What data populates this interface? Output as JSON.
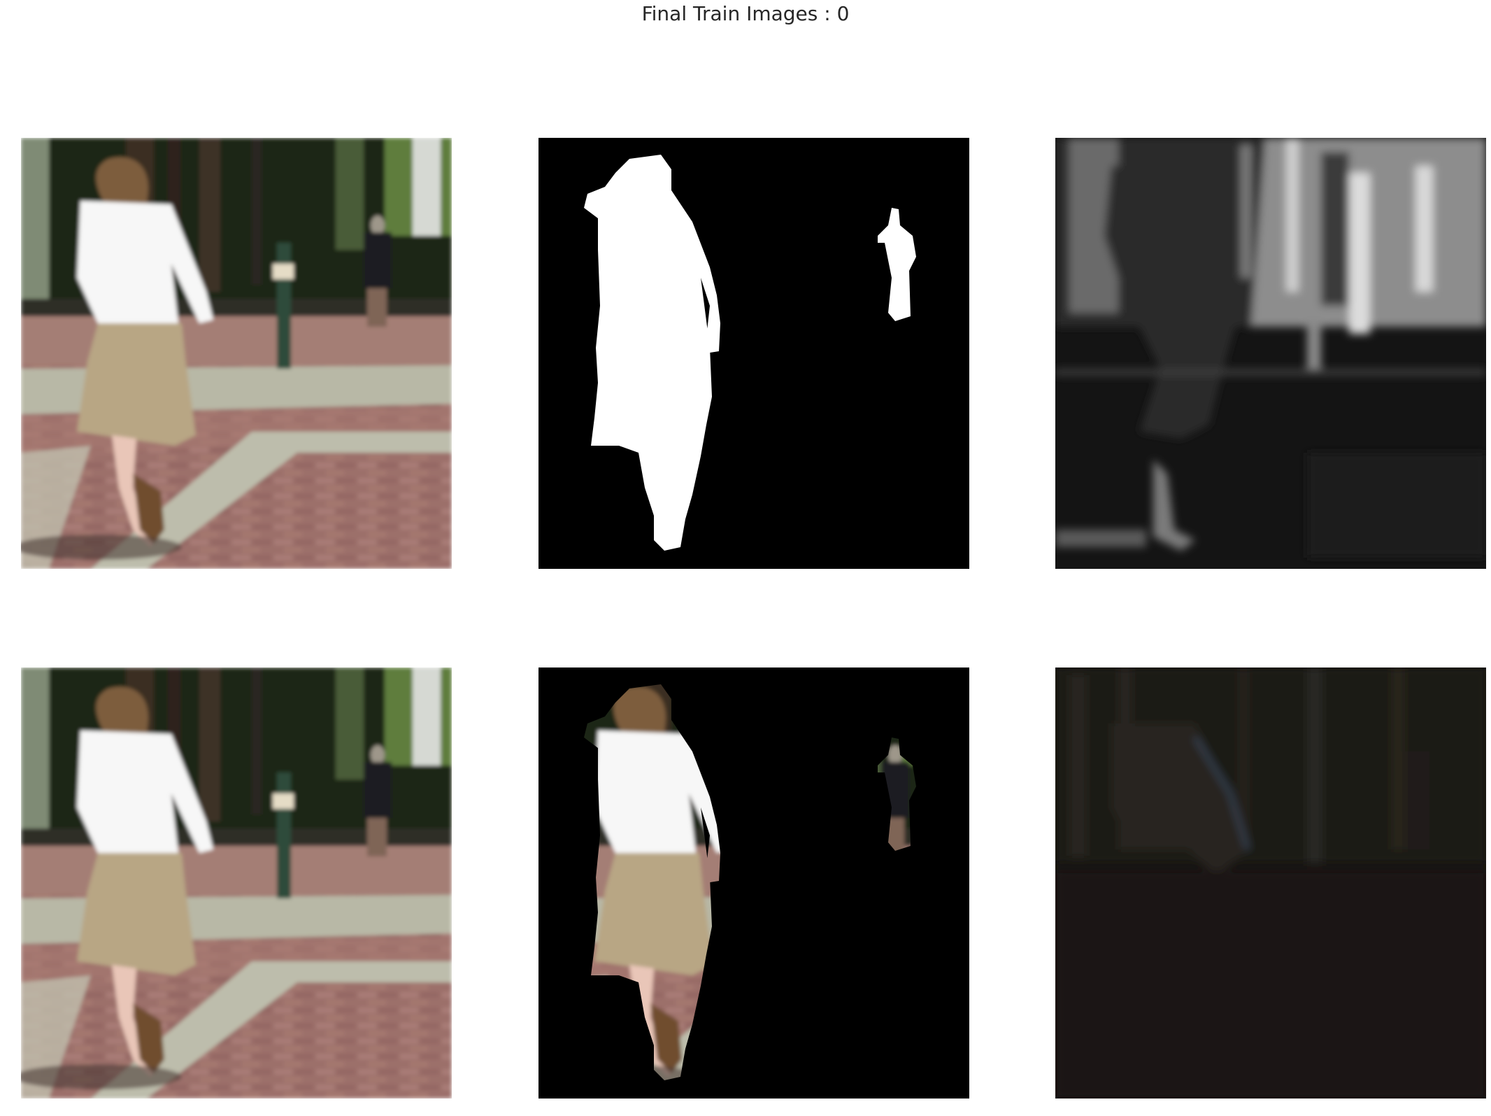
{
  "figure": {
    "suptitle": "Final Train Images : 0"
  },
  "panels": [
    {
      "id": "original-image-row1"
    },
    {
      "id": "binary-mask"
    },
    {
      "id": "feature-map-grayscale"
    },
    {
      "id": "original-image-row2"
    },
    {
      "id": "masked-color-image"
    },
    {
      "id": "feature-map-dark"
    }
  ],
  "colors": {
    "background": "#ffffff",
    "title": "#262626",
    "mask_foreground": "#ffffff",
    "mask_background": "#000000",
    "brick": "#9a6e6a",
    "sidewalk": "#b9b9a8",
    "skirt": "#b7a586",
    "shirt": "#f7f7f7",
    "trees": "#1d2418",
    "foliage": "#5c7a3c"
  }
}
